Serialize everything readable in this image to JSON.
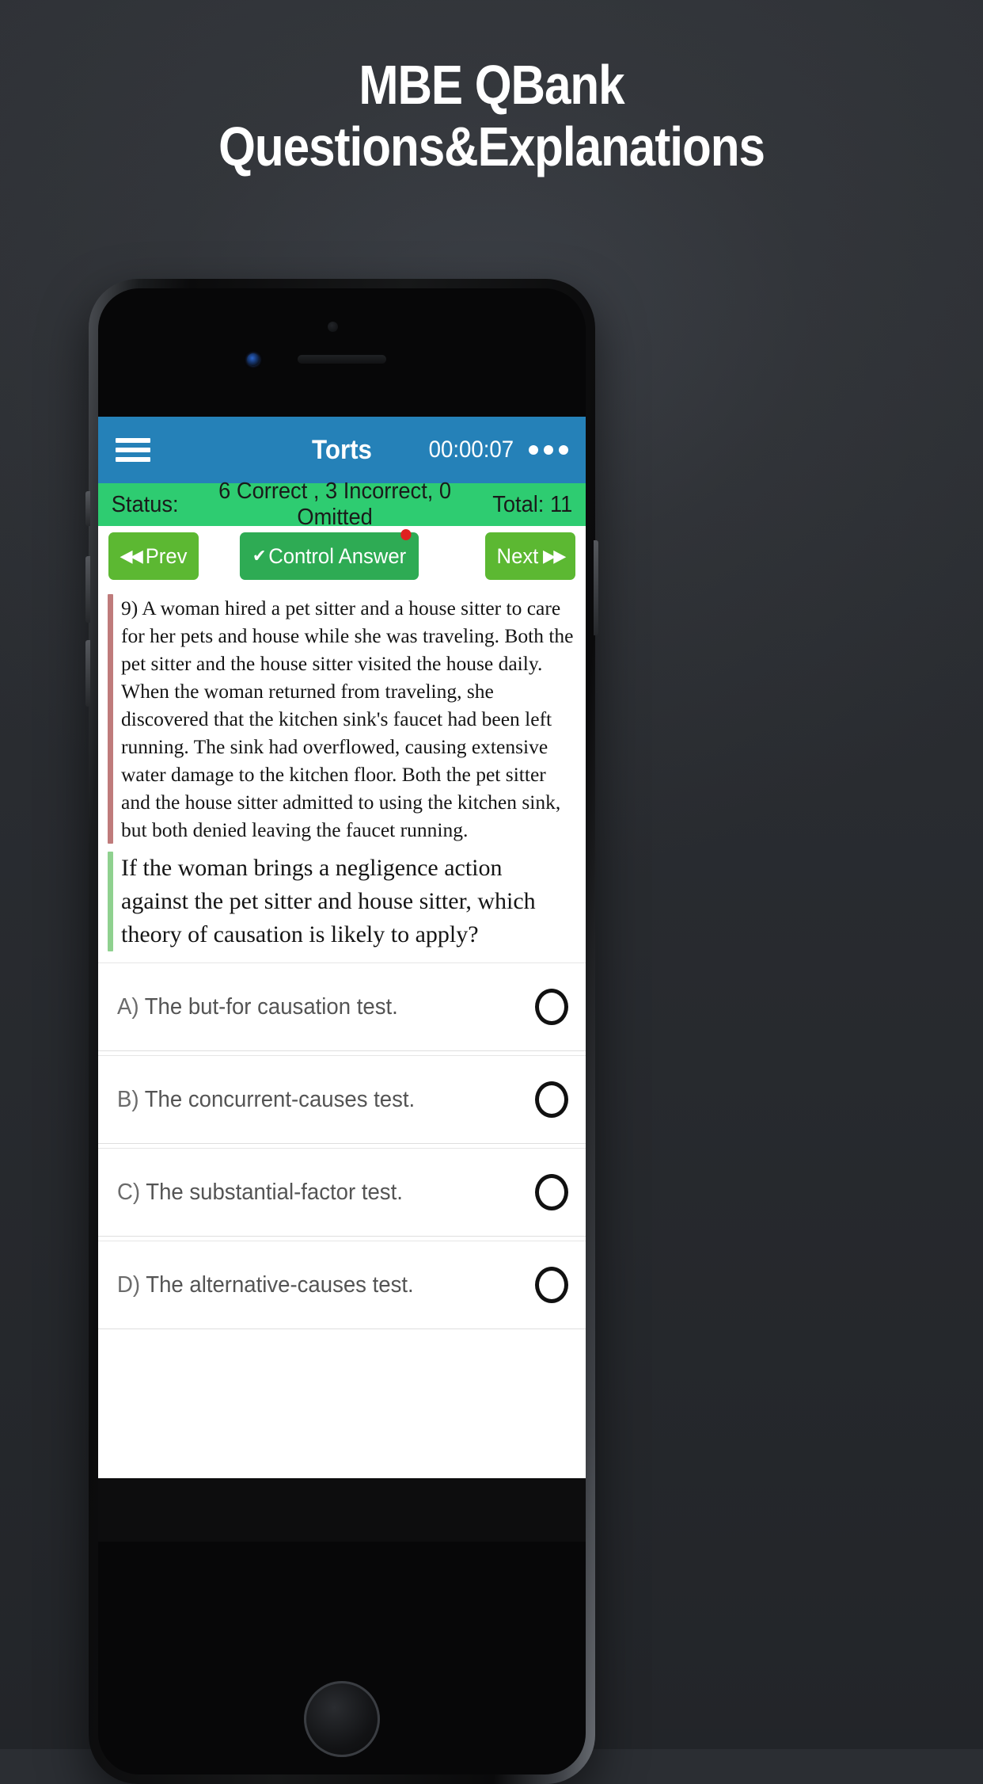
{
  "promo": {
    "headline_line1": "MBE QBank",
    "headline_line2": "Questions&Explanations",
    "background_color": "#2e3136",
    "headline_color": "#ffffff"
  },
  "app": {
    "appbar": {
      "menu_icon": "hamburger-menu-icon",
      "title": "Torts",
      "timer": "00:00:07",
      "overflow_icon": "more-options-icon",
      "background_color": "#2581b8"
    },
    "status": {
      "label": "Status:",
      "summary": "6 Correct , 3 Incorrect, 0 Omitted",
      "total": "Total: 11",
      "correct_count": 6,
      "incorrect_count": 3,
      "omitted_count": 0,
      "total_count": 11,
      "background_color": "#2ecc71"
    },
    "nav": {
      "prev_label": "Prev",
      "prev_icon": "double-chevron-left-icon",
      "control_label": "Control Answer",
      "control_icon": "check-mark-icon",
      "control_badge": "unread-dot",
      "next_label": "Next",
      "next_icon": "double-chevron-right-icon",
      "prev_color": "#5cb832",
      "control_color": "#2eab54",
      "badge_color": "#e02020"
    },
    "question": {
      "number": "9)",
      "stem": "9) A woman hired a pet sitter and a house sitter to care for her pets and house while she was traveling. Both the pet sitter and the house sitter visited the house daily. When the woman returned from traveling, she discovered that the kitchen sink's faucet had been left running. The sink had overflowed, causing extensive water damage to the kitchen floor. Both the pet sitter and the house sitter admitted to using the kitchen sink, but both denied leaving the faucet running.",
      "call": "If the woman brings a negligence action against the pet sitter and house sitter, which theory of causation is likely to apply?",
      "stem_accent_color": "#bf7b7b",
      "call_accent_color": "#8fd18f"
    },
    "options": [
      {
        "letter": "A)",
        "text": "The but-for causation test.",
        "selected": false
      },
      {
        "letter": "B)",
        "text": "The concurrent-causes test.",
        "selected": false
      },
      {
        "letter": "C)",
        "text": "The substantial-factor test.",
        "selected": false
      },
      {
        "letter": "D)",
        "text": "The alternative-causes test.",
        "selected": false
      }
    ]
  }
}
